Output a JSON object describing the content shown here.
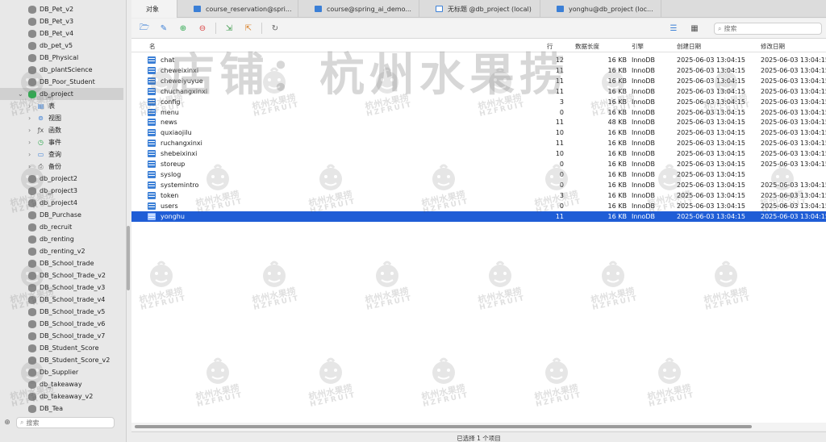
{
  "sidebar": {
    "items_before": [
      {
        "label": "DB_Pet_v2"
      },
      {
        "label": "DB_Pet_v3"
      },
      {
        "label": "DB_Pet_v4"
      },
      {
        "label": "db_pet_v5"
      },
      {
        "label": "DB_Physical"
      },
      {
        "label": "db_plantScience"
      },
      {
        "label": "DB_Poor_Student"
      }
    ],
    "open_db": {
      "label": "db_project"
    },
    "children": [
      {
        "label": "表",
        "icon": "table-icon"
      },
      {
        "label": "视图",
        "icon": "view-icon"
      },
      {
        "label": "函数",
        "icon": "function-icon"
      },
      {
        "label": "事件",
        "icon": "event-icon"
      },
      {
        "label": "查询",
        "icon": "query-icon"
      },
      {
        "label": "备份",
        "icon": "backup-icon"
      }
    ],
    "items_after": [
      {
        "label": "db_project2"
      },
      {
        "label": "db_project3"
      },
      {
        "label": "db_project4"
      },
      {
        "label": "DB_Purchase"
      },
      {
        "label": "db_recruit"
      },
      {
        "label": "db_renting"
      },
      {
        "label": "db_renting_v2"
      },
      {
        "label": "DB_School_trade"
      },
      {
        "label": "DB_School_Trade_v2"
      },
      {
        "label": "DB_School_trade_v3"
      },
      {
        "label": "DB_School_trade_v4"
      },
      {
        "label": "DB_School_trade_v5"
      },
      {
        "label": "DB_School_trade_v6"
      },
      {
        "label": "DB_School_trade_v7"
      },
      {
        "label": "DB_Student_Score"
      },
      {
        "label": "DB_Student_Score_v2"
      },
      {
        "label": "Db_Supplier"
      },
      {
        "label": "db_takeaway"
      },
      {
        "label": "db_takeaway_v2"
      },
      {
        "label": "DB_Tea"
      }
    ],
    "search_placeholder": "搜索"
  },
  "tabs": [
    {
      "label": "对象",
      "active": true
    },
    {
      "label": "course_reservation@spri..."
    },
    {
      "label": "course@spring_ai_demo..."
    },
    {
      "label": "无标题 @db_project (local)"
    },
    {
      "label": "yonghu@db_project (loc..."
    }
  ],
  "toolbar": {
    "search_placeholder": "搜索"
  },
  "table": {
    "headers": {
      "name": "名",
      "rows": "行",
      "data_length": "数据长度",
      "engine": "引擎",
      "created": "创建日期",
      "modified": "修改日期"
    },
    "rows": [
      {
        "name": "chat",
        "rows": "12",
        "size": "16 KB",
        "engine": "InnoDB",
        "created": "2025-06-03 13:04:15",
        "modified": "2025-06-03 13:04:15"
      },
      {
        "name": "cheweixinxi",
        "rows": "11",
        "size": "16 KB",
        "engine": "InnoDB",
        "created": "2025-06-03 13:04:15",
        "modified": "2025-06-03 13:04:15"
      },
      {
        "name": "cheweiyuyue",
        "rows": "11",
        "size": "16 KB",
        "engine": "InnoDB",
        "created": "2025-06-03 13:04:15",
        "modified": "2025-06-03 13:04:15"
      },
      {
        "name": "chuchangxinxi",
        "rows": "11",
        "size": "16 KB",
        "engine": "InnoDB",
        "created": "2025-06-03 13:04:15",
        "modified": "2025-06-03 13:04:15"
      },
      {
        "name": "config",
        "rows": "3",
        "size": "16 KB",
        "engine": "InnoDB",
        "created": "2025-06-03 13:04:15",
        "modified": "2025-06-03 13:04:15"
      },
      {
        "name": "menu",
        "rows": "0",
        "size": "16 KB",
        "engine": "InnoDB",
        "created": "2025-06-03 13:04:15",
        "modified": "2025-06-03 13:04:15"
      },
      {
        "name": "news",
        "rows": "11",
        "size": "48 KB",
        "engine": "InnoDB",
        "created": "2025-06-03 13:04:15",
        "modified": "2025-06-03 13:04:15"
      },
      {
        "name": "quxiaojilu",
        "rows": "10",
        "size": "16 KB",
        "engine": "InnoDB",
        "created": "2025-06-03 13:04:15",
        "modified": "2025-06-03 13:04:15"
      },
      {
        "name": "ruchangxinxi",
        "rows": "11",
        "size": "16 KB",
        "engine": "InnoDB",
        "created": "2025-06-03 13:04:15",
        "modified": "2025-06-03 13:04:15"
      },
      {
        "name": "shebeixinxi",
        "rows": "10",
        "size": "16 KB",
        "engine": "InnoDB",
        "created": "2025-06-03 13:04:15",
        "modified": "2025-06-03 13:04:15"
      },
      {
        "name": "storeup",
        "rows": "0",
        "size": "16 KB",
        "engine": "InnoDB",
        "created": "2025-06-03 13:04:15",
        "modified": "2025-06-03 13:04:15"
      },
      {
        "name": "syslog",
        "rows": "0",
        "size": "16 KB",
        "engine": "InnoDB",
        "created": "2025-06-03 13:04:15",
        "modified": ""
      },
      {
        "name": "systemintro",
        "rows": "0",
        "size": "16 KB",
        "engine": "InnoDB",
        "created": "2025-06-03 13:04:15",
        "modified": "2025-06-03 13:04:15"
      },
      {
        "name": "token",
        "rows": "3",
        "size": "16 KB",
        "engine": "InnoDB",
        "created": "2025-06-03 13:04:15",
        "modified": "2025-06-03 13:04:15"
      },
      {
        "name": "users",
        "rows": "0",
        "size": "16 KB",
        "engine": "InnoDB",
        "created": "2025-06-03 13:04:15",
        "modified": "2025-06-03 13:04:15"
      },
      {
        "name": "yonghu",
        "rows": "11",
        "size": "16 KB",
        "engine": "InnoDB",
        "created": "2025-06-03 13:04:15",
        "modified": "2025-06-03 13:04:15",
        "selected": true
      }
    ]
  },
  "status": {
    "text": "已选择 1 个项目"
  },
  "watermark": {
    "text": "店铺：杭州水果捞",
    "small_cn": "杭州水果捞",
    "small_en": "HZFRUIT"
  },
  "colors": {
    "selection": "#1f5dd6",
    "table_icon": "#3b7fd6",
    "open_db": "#34a853"
  }
}
